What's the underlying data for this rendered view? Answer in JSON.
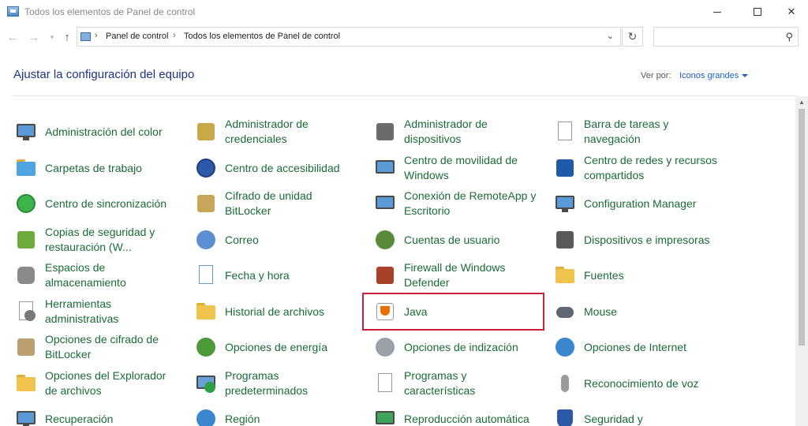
{
  "window": {
    "title": "Todos los elementos de Panel de control"
  },
  "address": {
    "breadcrumbs": [
      "Panel de control",
      "Todos los elementos de Panel de control"
    ],
    "search_placeholder": ""
  },
  "header": {
    "title": "Ajustar la configuración del equipo",
    "view_by_label": "Ver por:",
    "view_by_value": "Iconos grandes"
  },
  "items": {
    "c0": [
      {
        "line1": "Administración del color",
        "line2": "",
        "icon": "color-management-icon"
      },
      {
        "line1": "Carpetas de trabajo",
        "line2": "",
        "icon": "work-folders-icon"
      },
      {
        "line1": "Centro de sincronización",
        "line2": "",
        "icon": "sync-center-icon"
      },
      {
        "line1": "Copias de seguridad y",
        "line2": "restauración (W...",
        "icon": "backup-restore-icon"
      },
      {
        "line1": "Espacios de",
        "line2": "almacenamiento",
        "icon": "storage-spaces-icon"
      },
      {
        "line1": "Herramientas",
        "line2": "administrativas",
        "icon": "admin-tools-icon"
      },
      {
        "line1": "Opciones de cifrado de",
        "line2": "BitLocker",
        "icon": "bitlocker-options-icon"
      },
      {
        "line1": "Opciones del Explorador",
        "line2": "de archivos",
        "icon": "explorer-options-icon"
      },
      {
        "line1": "Recuperación",
        "line2": "",
        "icon": "recovery-icon"
      }
    ],
    "c1": [
      {
        "line1": "Administrador de",
        "line2": "credenciales",
        "icon": "credential-manager-icon"
      },
      {
        "line1": "Centro de accesibilidad",
        "line2": "",
        "icon": "accessibility-icon"
      },
      {
        "line1": "Cifrado de unidad",
        "line2": "BitLocker",
        "icon": "bitlocker-icon"
      },
      {
        "line1": "Correo",
        "line2": "",
        "icon": "mail-icon"
      },
      {
        "line1": "Fecha y hora",
        "line2": "",
        "icon": "date-time-icon"
      },
      {
        "line1": "Historial de archivos",
        "line2": "",
        "icon": "file-history-icon"
      },
      {
        "line1": "Opciones de energía",
        "line2": "",
        "icon": "power-options-icon"
      },
      {
        "line1": "Programas",
        "line2": "predeterminados",
        "icon": "default-programs-icon"
      },
      {
        "line1": "Región",
        "line2": "",
        "icon": "region-icon"
      }
    ],
    "c2": [
      {
        "line1": "Administrador de",
        "line2": "dispositivos",
        "icon": "device-manager-icon"
      },
      {
        "line1": "Centro de movilidad de",
        "line2": "Windows",
        "icon": "mobility-center-icon"
      },
      {
        "line1": "Conexión de RemoteApp y",
        "line2": "Escritorio",
        "icon": "remoteapp-icon"
      },
      {
        "line1": "Cuentas de usuario",
        "line2": "",
        "icon": "user-accounts-icon"
      },
      {
        "line1": "Firewall de Windows",
        "line2": "Defender",
        "icon": "firewall-icon"
      },
      {
        "line1": "Java",
        "line2": "",
        "icon": "java-icon"
      },
      {
        "line1": "Opciones de indización",
        "line2": "",
        "icon": "indexing-options-icon"
      },
      {
        "line1": "Programas y",
        "line2": "características",
        "icon": "programs-features-icon"
      },
      {
        "line1": "Reproducción automática",
        "line2": "",
        "icon": "autoplay-icon"
      }
    ],
    "c3": [
      {
        "line1": "Barra de tareas y",
        "line2": "navegación",
        "icon": "taskbar-icon"
      },
      {
        "line1": "Centro de redes y recursos",
        "line2": "compartidos",
        "icon": "network-center-icon"
      },
      {
        "line1": "Configuration Manager",
        "line2": "",
        "icon": "configuration-manager-icon"
      },
      {
        "line1": "Dispositivos e impresoras",
        "line2": "",
        "icon": "devices-printers-icon"
      },
      {
        "line1": "Fuentes",
        "line2": "",
        "icon": "fonts-icon"
      },
      {
        "line1": "Mouse",
        "line2": "",
        "icon": "mouse-icon"
      },
      {
        "line1": "Opciones de Internet",
        "line2": "",
        "icon": "internet-options-icon"
      },
      {
        "line1": "Reconocimiento de voz",
        "line2": "",
        "icon": "speech-recognition-icon"
      },
      {
        "line1": "Seguridad y",
        "line2": "",
        "icon": "security-maintenance-icon"
      }
    ]
  }
}
